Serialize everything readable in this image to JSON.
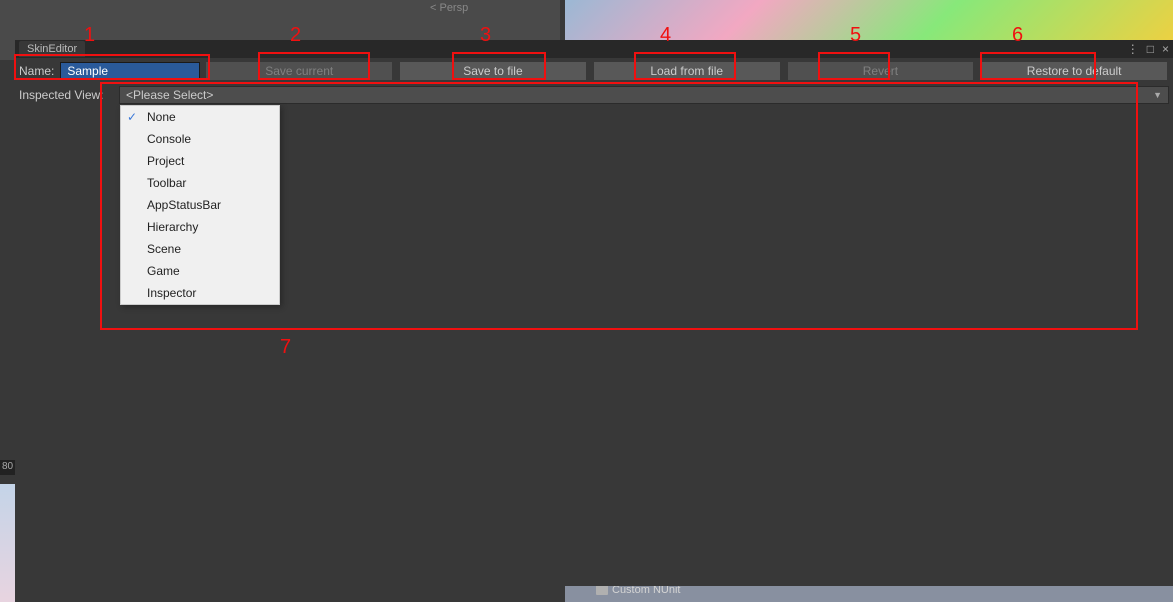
{
  "background": {
    "persp_text": "< Persp",
    "bottom_left": "80",
    "bottom_tab": "Custom NUnit"
  },
  "window": {
    "title": "SkinEditor",
    "controls": {
      "menu": "⋮",
      "maximize": "□",
      "close": "×"
    }
  },
  "toolbar": {
    "name_label": "Name:",
    "name_value": "Sample",
    "buttons": {
      "save_current": "Save current",
      "save_to_file": "Save to file",
      "load_from_file": "Load from file",
      "revert": "Revert",
      "restore_default": "Restore to default"
    }
  },
  "inspected": {
    "label": "Inspected View:",
    "selected": "<Please Select>",
    "options": [
      {
        "label": "None",
        "checked": true
      },
      {
        "label": "Console",
        "checked": false
      },
      {
        "label": "Project",
        "checked": false
      },
      {
        "label": "Toolbar",
        "checked": false
      },
      {
        "label": "AppStatusBar",
        "checked": false
      },
      {
        "label": "Hierarchy",
        "checked": false
      },
      {
        "label": "Scene",
        "checked": false
      },
      {
        "label": "Game",
        "checked": false
      },
      {
        "label": "Inspector",
        "checked": false
      }
    ]
  },
  "annotations": {
    "n1": "1",
    "n2": "2",
    "n3": "3",
    "n4": "4",
    "n5": "5",
    "n6": "6",
    "n7": "7"
  }
}
